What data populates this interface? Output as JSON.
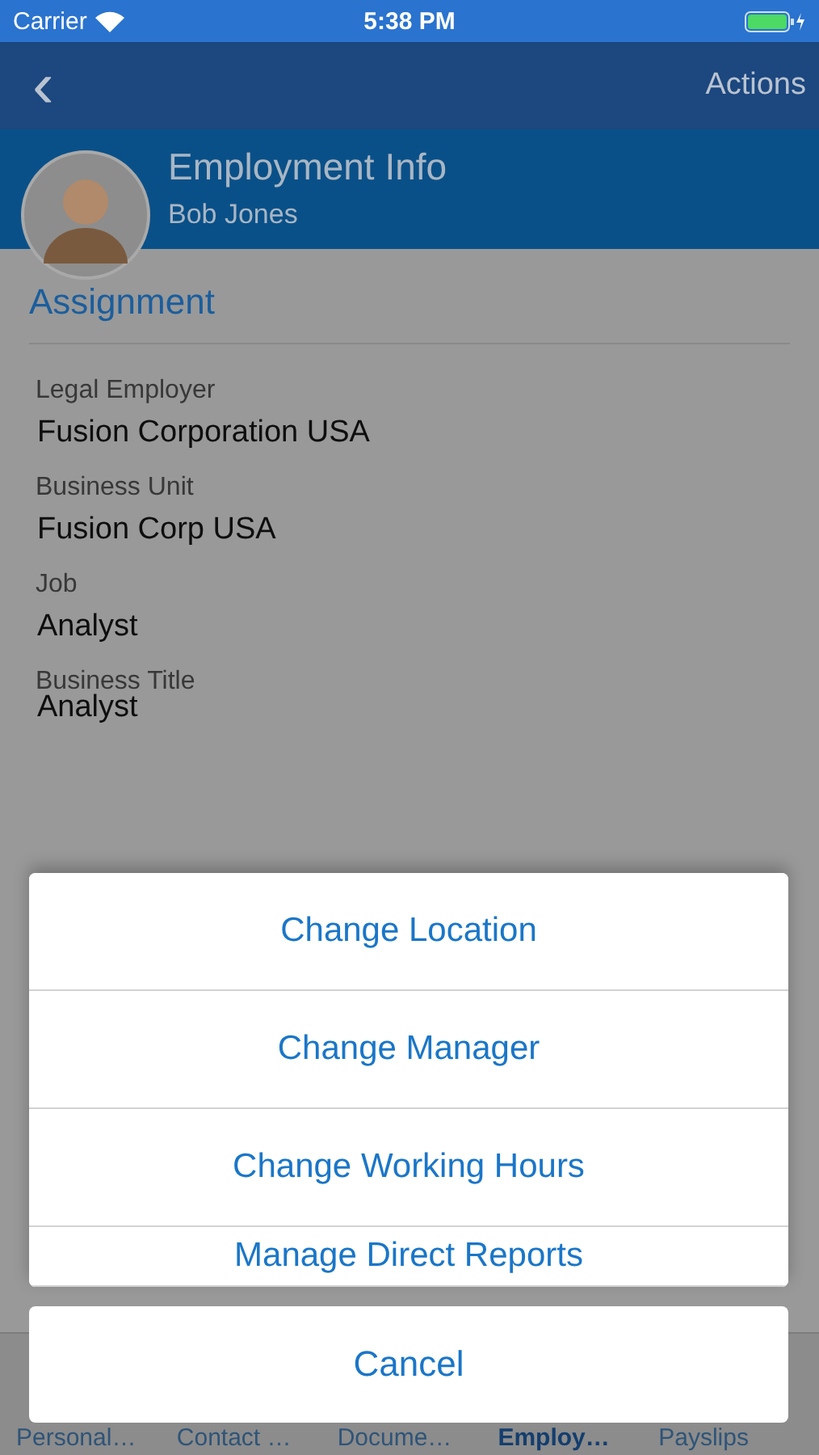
{
  "status_bar": {
    "carrier": "Carrier",
    "time": "5:38 PM"
  },
  "nav_bar": {
    "back": "‹",
    "action": "Actions"
  },
  "header": {
    "title": "Employment Info",
    "name": "Bob Jones"
  },
  "section": {
    "title": "Assignment",
    "fields": [
      {
        "label": "Legal Employer",
        "value": "Fusion Corporation USA"
      },
      {
        "label": "Business Unit",
        "value": "Fusion Corp USA"
      },
      {
        "label": "Job",
        "value": "Analyst"
      },
      {
        "label": "Business Title",
        "value": "Analyst"
      }
    ]
  },
  "action_sheet": {
    "actions": [
      {
        "label": "Change Location"
      },
      {
        "label": "Change Manager"
      },
      {
        "label": "Change Working Hours"
      },
      {
        "label": "Manage Direct Reports"
      }
    ],
    "cancel": "Cancel"
  },
  "tab_bar": {
    "tabs": [
      {
        "label": "Personal…",
        "selected": false
      },
      {
        "label": "Contact …",
        "selected": false
      },
      {
        "label": "Docume…",
        "selected": false
      },
      {
        "label": "Employ…",
        "selected": true
      },
      {
        "label": "Payslips",
        "selected": false
      }
    ]
  }
}
